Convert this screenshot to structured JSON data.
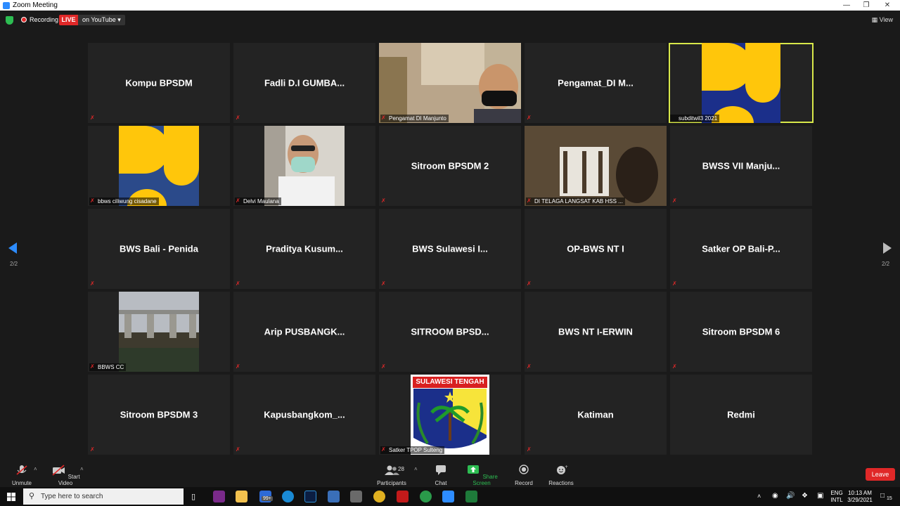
{
  "window": {
    "title": "Zoom Meeting"
  },
  "topbar": {
    "recording_label": "Recording",
    "live_label": "LIVE",
    "youtube_label": "on YouTube ▾",
    "view_label": "View"
  },
  "pager": {
    "left": "2/2",
    "right": "2/2"
  },
  "tiles": [
    {
      "name": "Kompu BPSDM"
    },
    {
      "name": "Fadli D.I GUMBA..."
    },
    {
      "label": "Pengamat DI Manjunto"
    },
    {
      "name": "Pengamat_DI M..."
    },
    {
      "label": "subditwil3 2021"
    },
    {
      "label": "bbws ciliwung cisadane"
    },
    {
      "label": "Delvi Maulana"
    },
    {
      "name": "Sitroom BPSDM 2"
    },
    {
      "label": "DI TELAGA LANGSAT KAB HSS ..."
    },
    {
      "name": "BWSS VII Manju..."
    },
    {
      "name": "BWS Bali - Penida"
    },
    {
      "name": "Praditya Kusum..."
    },
    {
      "name": "BWS Sulawesi I..."
    },
    {
      "name": "OP-BWS NT I"
    },
    {
      "name": "Satker OP Bali-P..."
    },
    {
      "label": "BBWS CC"
    },
    {
      "name": "Arip PUSBANGK..."
    },
    {
      "name": "SITROOM BPSD..."
    },
    {
      "name": "BWS NT I-ERWIN"
    },
    {
      "name": "Sitroom BPSDM 6"
    },
    {
      "name": "Sitroom BPSDM 3"
    },
    {
      "name": "Kapusbangkom_..."
    },
    {
      "label": "Satker TPOP Sulteng",
      "logo_text": "SULAWESI TENGAH"
    },
    {
      "name": "Katiman"
    },
    {
      "name": "Redmi"
    }
  ],
  "toolbar": {
    "unmute": "Unmute",
    "start_video": "Start Video",
    "participants": "Participants",
    "participant_count": "28",
    "chat": "Chat",
    "share_screen": "Share Screen",
    "record": "Record",
    "reactions": "Reactions",
    "leave": "Leave"
  },
  "taskbar": {
    "search_placeholder": "Type here to search",
    "lang_top": "ENG",
    "lang_bottom": "INTL",
    "time": "10:13 AM",
    "date": "3/29/2021",
    "badge": "99+",
    "notif": "15"
  },
  "colors": {
    "accent": "#2d8cff",
    "live": "#e02828",
    "active_speaker": "#d8e84a",
    "share_green": "#2dbd52",
    "pu_yellow": "#ffc60b",
    "pu_blue": "#1b2f8a"
  }
}
